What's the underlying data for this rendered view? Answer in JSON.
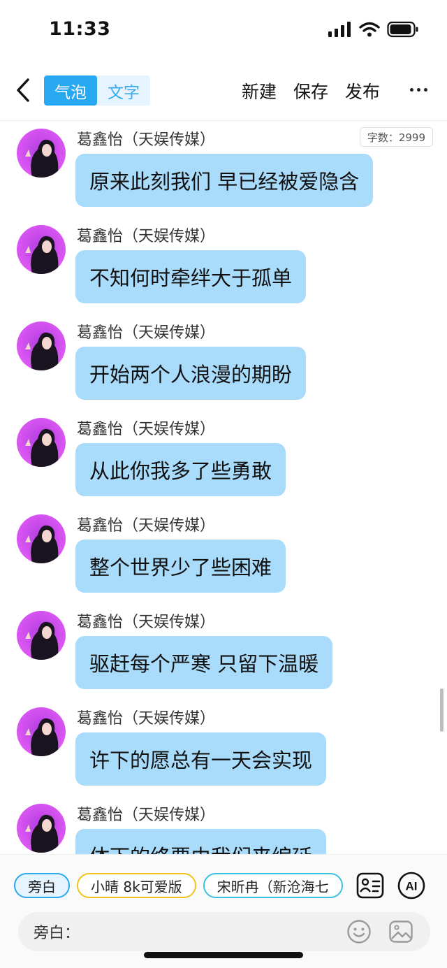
{
  "status_bar": {
    "time": "11:33"
  },
  "nav": {
    "segments": [
      {
        "label": "气泡",
        "active": true
      },
      {
        "label": "文字",
        "active": false
      }
    ],
    "actions": [
      "新建",
      "保存",
      "发布"
    ],
    "more_icon": "more-horizontal-icon",
    "back_icon": "chevron-left-icon"
  },
  "word_count": "字数：2999",
  "messages": [
    {
      "name": "葛鑫怡（天娱传媒）",
      "text": "原来此刻我们 早已经被爱隐含"
    },
    {
      "name": "葛鑫怡（天娱传媒）",
      "text": "不知何时牵绊大于孤单"
    },
    {
      "name": "葛鑫怡（天娱传媒）",
      "text": "开始两个人浪漫的期盼"
    },
    {
      "name": "葛鑫怡（天娱传媒）",
      "text": "从此你我多了些勇敢"
    },
    {
      "name": "葛鑫怡（天娱传媒）",
      "text": "整个世界少了些困难"
    },
    {
      "name": "葛鑫怡（天娱传媒）",
      "text": "驱赶每个严寒 只留下温暖"
    },
    {
      "name": "葛鑫怡（天娱传媒）",
      "text": "许下的愿总有一天会实现"
    },
    {
      "name": "葛鑫怡（天娱传媒）",
      "text": "体下的终要由我们来编延"
    }
  ],
  "bottom": {
    "chips": [
      {
        "label": "旁白",
        "style": "blue"
      },
      {
        "label": "小晴 8k可爱版",
        "style": "yellow"
      },
      {
        "label": "宋昕冉（新沧海七",
        "style": "teal"
      }
    ],
    "tools": [
      "contact-card-icon",
      "ai-icon"
    ],
    "ai_label": "AI",
    "input_prefix": "旁白：",
    "input_value": "",
    "emoji_icon": "emoji-icon",
    "image_icon": "image-icon"
  },
  "colors": {
    "accent": "#29a8f2",
    "bubble": "#a9dbfb",
    "chip_yellow": "#f2c21b",
    "chip_teal": "#37c1e3"
  }
}
